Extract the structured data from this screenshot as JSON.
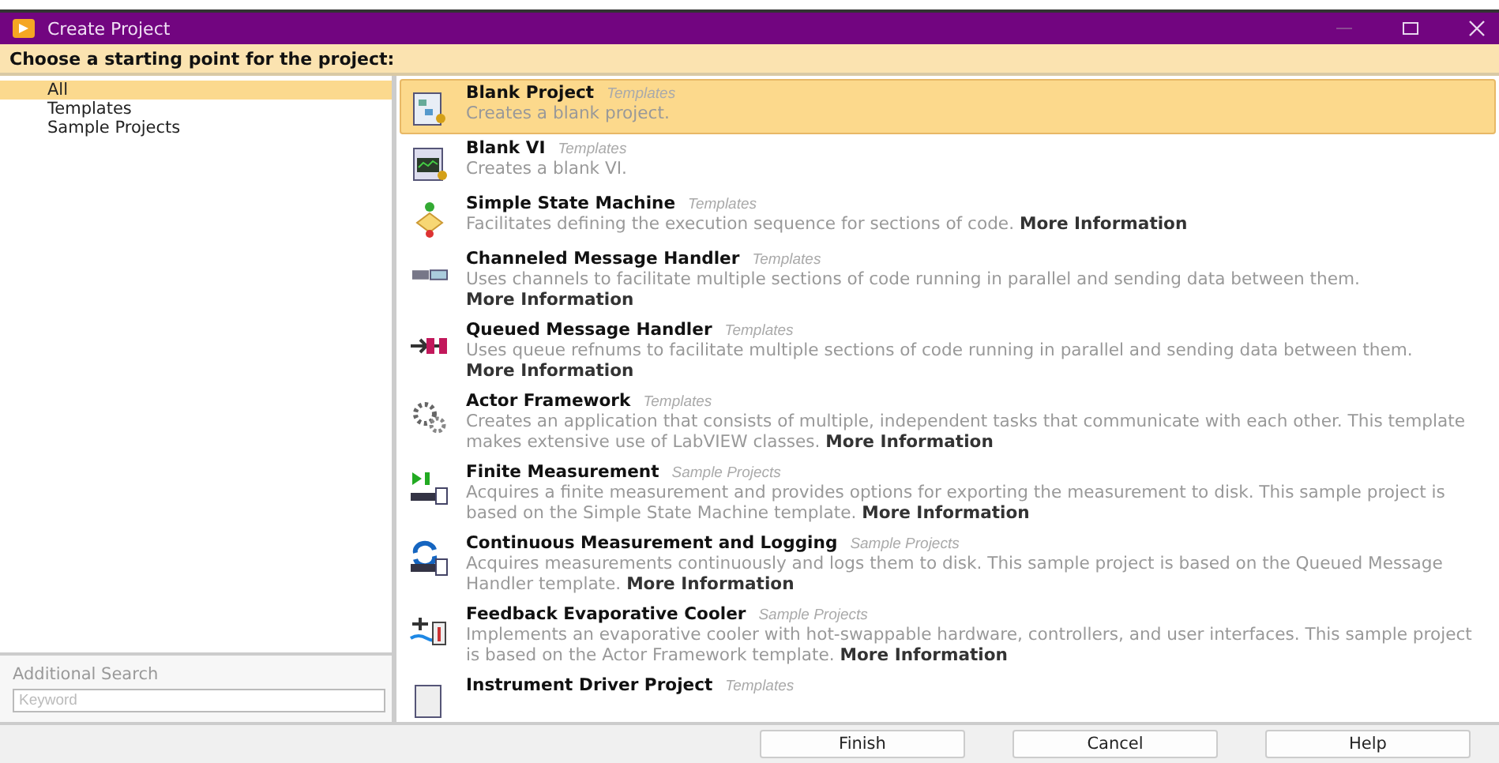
{
  "window": {
    "title": "Create Project"
  },
  "header": "Choose a starting point for the project:",
  "categories": [
    {
      "label": "All",
      "selected": true
    },
    {
      "label": "Templates",
      "selected": false
    },
    {
      "label": "Sample Projects",
      "selected": false
    }
  ],
  "additional_search": {
    "label": "Additional Search",
    "placeholder": "Keyword"
  },
  "items": [
    {
      "title": "Blank Project",
      "category": "Templates",
      "description": "Creates a blank project.",
      "selected": true
    },
    {
      "title": "Blank VI",
      "category": "Templates",
      "description": "Creates a blank VI.",
      "selected": false
    },
    {
      "title": "Simple State Machine",
      "category": "Templates",
      "description": "Facilitates defining the execution sequence for sections of code.",
      "link": "More Information",
      "selected": false
    },
    {
      "title": "Channeled Message Handler",
      "category": "Templates",
      "description": "Uses channels to facilitate multiple sections of code running in parallel and sending data between them.",
      "link": "More Information",
      "selected": false
    },
    {
      "title": "Queued Message Handler",
      "category": "Templates",
      "description": "Uses queue refnums to facilitate multiple sections of code running in parallel and sending data between them.",
      "link": "More Information",
      "selected": false
    },
    {
      "title": "Actor Framework",
      "category": "Templates",
      "description": "Creates an application that consists of multiple, independent tasks that communicate with each other. This template makes extensive use of LabVIEW classes.",
      "link": "More Information",
      "selected": false
    },
    {
      "title": "Finite Measurement",
      "category": "Sample Projects",
      "description": "Acquires a finite measurement and provides options for exporting the measurement to disk. This sample project is based on the Simple State Machine template.",
      "link": "More Information",
      "selected": false
    },
    {
      "title": "Continuous Measurement and Logging",
      "category": "Sample Projects",
      "description": "Acquires measurements continuously and logs them to disk. This sample project is based on the Queued Message Handler template.",
      "link": "More Information",
      "selected": false
    },
    {
      "title": "Feedback Evaporative Cooler",
      "category": "Sample Projects",
      "description": "Implements an evaporative cooler with hot-swappable hardware, controllers, and user interfaces. This sample project is based on the Actor Framework template.",
      "link": "More Information",
      "selected": false
    },
    {
      "title": "Instrument Driver Project",
      "category": "Templates",
      "selected": false
    }
  ],
  "buttons": [
    "Finish",
    "Cancel",
    "Help"
  ]
}
